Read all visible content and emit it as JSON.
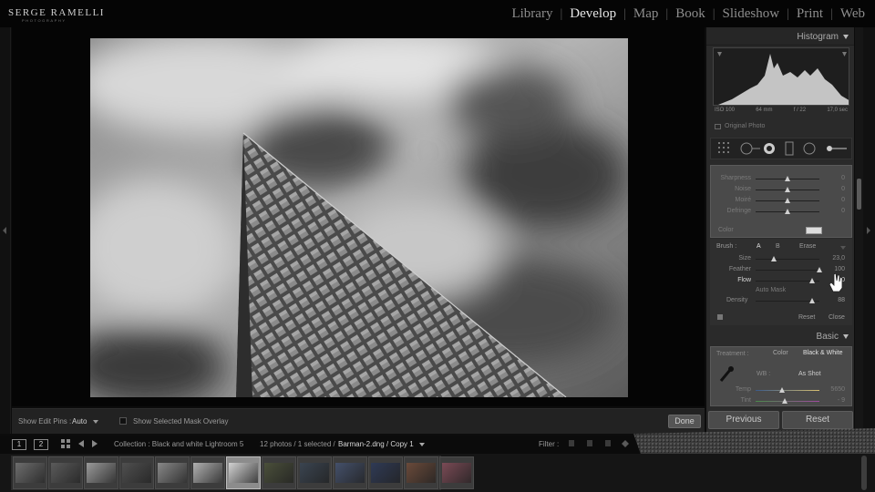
{
  "brand": {
    "name": "SERGE RAMELLI",
    "sub": "PHOTOGRAPHY"
  },
  "modules": [
    {
      "label": "Library",
      "active": false
    },
    {
      "label": "Develop",
      "active": true
    },
    {
      "label": "Map",
      "active": false
    },
    {
      "label": "Book",
      "active": false
    },
    {
      "label": "Slideshow",
      "active": false
    },
    {
      "label": "Print",
      "active": false
    },
    {
      "label": "Web",
      "active": false
    }
  ],
  "module_sep": "|",
  "toolbar": {
    "show_edit_pins_label": "Show Edit Pins :",
    "show_edit_pins_value": "Auto",
    "show_mask_overlay_label": "Show Selected Mask Overlay",
    "done_label": "Done"
  },
  "histogram": {
    "title": "Histogram",
    "iso": "ISO 100",
    "focal": "64 mm",
    "aperture": "f / 22",
    "shutter": "17,0 sec",
    "original_photo_label": "Original Photo"
  },
  "detail": {
    "rows": [
      {
        "label": "Sharpness",
        "value": "0",
        "pos": 0.5
      },
      {
        "label": "Noise",
        "value": "0",
        "pos": 0.5
      },
      {
        "label": "Moiré",
        "value": "0",
        "pos": 0.5
      },
      {
        "label": "Defringe",
        "value": "0",
        "pos": 0.5
      }
    ],
    "color_label": "Color"
  },
  "brush": {
    "label": "Brush :",
    "a": "A",
    "b": "B",
    "erase": "Erase",
    "rows": [
      {
        "label": "Size",
        "value": "23,0",
        "pos": 0.28
      },
      {
        "label": "Feather",
        "value": "100",
        "pos": 1.0
      },
      {
        "label": "Flow",
        "value": "100",
        "pos": 0.88
      }
    ],
    "auto_mask_label": "Auto Mask",
    "density_label": "Density",
    "density_value": "88",
    "density_pos": 0.88,
    "reset_label": "Reset",
    "close_label": "Close"
  },
  "basic": {
    "title": "Basic",
    "treatment_label": "Treatment :",
    "color_option": "Color",
    "bw_option": "Black & White",
    "wb_label": "WB :",
    "wb_value": "As Shot",
    "temp_label": "Temp",
    "temp_value": "5650",
    "temp_pos": 0.42,
    "tint_label": "Tint",
    "tint_value": "- 9",
    "tint_pos": 0.46
  },
  "buttons": {
    "previous": "Previous",
    "reset": "Reset"
  },
  "filmstrip": {
    "screen1": "1",
    "screen2": "2",
    "collection": "Collection : Black and white Lightroom 5",
    "count": "12 photos / 1 selected /",
    "filename": "Barman-2.dng / Copy 1",
    "filter_label": "Filter :",
    "thumbs": [
      {
        "tone": "#6d6d6d",
        "selected": false
      },
      {
        "tone": "#5a5a5a",
        "selected": false
      },
      {
        "tone": "#9a9a9a",
        "selected": false
      },
      {
        "tone": "#4f4f4f",
        "selected": false
      },
      {
        "tone": "#888888",
        "selected": false
      },
      {
        "tone": "#b0b0b0",
        "selected": false
      },
      {
        "tone": "#d2d2d2",
        "selected": true
      },
      {
        "tone": "#4a4f3a",
        "selected": false
      },
      {
        "tone": "#3a4450",
        "selected": false
      },
      {
        "tone": "#44506a",
        "selected": false
      },
      {
        "tone": "#2f3a55",
        "selected": false
      },
      {
        "tone": "#6a4a3a",
        "selected": false
      },
      {
        "tone": "#7a4a55",
        "selected": false
      }
    ]
  }
}
